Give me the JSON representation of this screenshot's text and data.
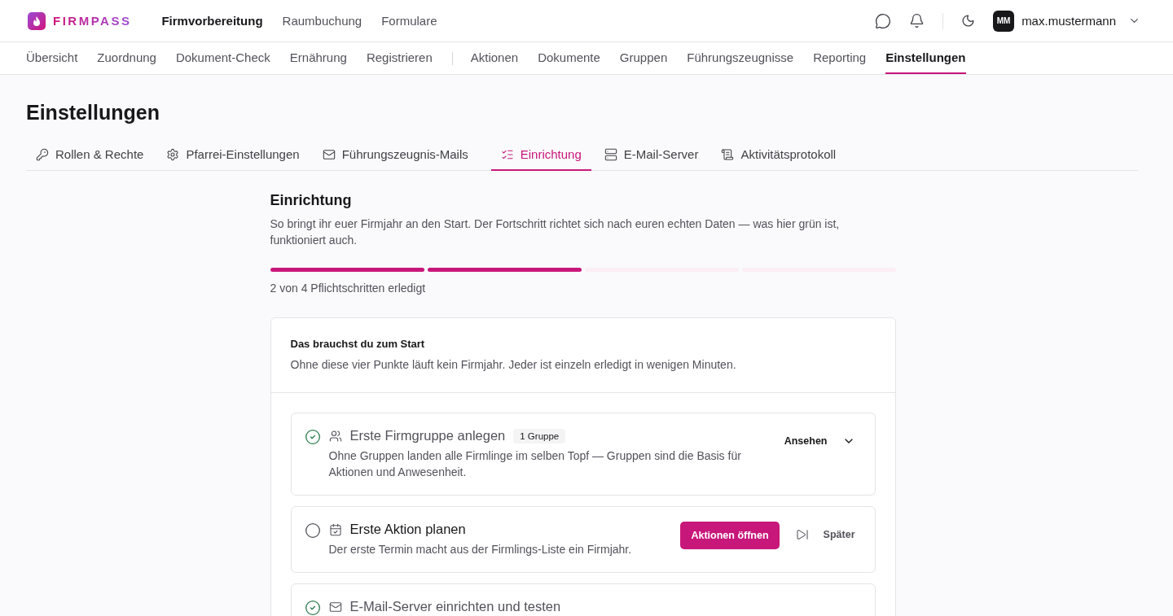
{
  "brand": {
    "name": "FIRMPASS"
  },
  "main_nav": [
    {
      "label": "Firmvorbereitung",
      "selected": true
    },
    {
      "label": "Raumbuchung",
      "selected": false
    },
    {
      "label": "Formulare",
      "selected": false
    }
  ],
  "user": {
    "initials": "MM",
    "name": "max.mustermann"
  },
  "sub_nav": [
    [
      {
        "label": "Übersicht",
        "selected": false
      },
      {
        "label": "Zuordnung",
        "selected": false
      },
      {
        "label": "Dokument-Check",
        "selected": false
      },
      {
        "label": "Ernährung",
        "selected": false
      },
      {
        "label": "Registrieren",
        "selected": false
      }
    ],
    [
      {
        "label": "Aktionen",
        "selected": false
      },
      {
        "label": "Dokumente",
        "selected": false
      },
      {
        "label": "Gruppen",
        "selected": false
      },
      {
        "label": "Führungszeugnisse",
        "selected": false
      },
      {
        "label": "Reporting",
        "selected": false
      },
      {
        "label": "Einstellungen",
        "selected": true
      }
    ]
  ],
  "page_title": "Einstellungen",
  "tabs": [
    {
      "label": "Rollen & Rechte",
      "kind": "key",
      "selected": false
    },
    {
      "label": "Pfarrei-Einstellungen",
      "kind": "gear",
      "selected": false
    },
    {
      "label": "Führungszeugnis-Mails",
      "kind": "mail",
      "selected": false
    },
    {
      "label": "Einrichtung",
      "kind": "checklist",
      "selected": true
    },
    {
      "label": "E-Mail-Server",
      "kind": "server",
      "selected": false
    },
    {
      "label": "Aktivitätsprotokoll",
      "kind": "scroll",
      "selected": false
    }
  ],
  "section": {
    "title": "Einrichtung",
    "description": "So bringt ihr euer Firmjahr an den Start. Der Fortschritt richtet sich nach euren echten Daten — was hier grün ist, funktioniert auch.",
    "progress": [
      {
        "done": true
      },
      {
        "done": true
      },
      {
        "done": false
      },
      {
        "done": false
      }
    ],
    "progress_text": "2 von 4 Pflichtschritten erledigt"
  },
  "card": {
    "title": "Das brauchst du zum Start",
    "description": "Ohne diese vier Punkte läuft kein Firmjahr. Jeder ist einzeln erledigt in wenigen Minuten.",
    "steps": [
      {
        "done": true,
        "kind": "users",
        "title": "Erste Firmgruppe anlegen",
        "badge": "1 Gruppe",
        "description": "Ohne Gruppen landen alle Firmlinge im selben Topf — Gruppen sind die Basis für Aktionen und Anwesenheit.",
        "view_label": "Ansehen"
      },
      {
        "done": false,
        "kind": "calendar",
        "title": "Erste Aktion planen",
        "description": "Der erste Termin macht aus der Firmlings-Liste ein Firmjahr.",
        "primary_label": "Aktionen öffnen",
        "later_label": "Später"
      },
      {
        "done": true,
        "kind": "mail",
        "title": "E-Mail-Server einrichten und testen"
      }
    ]
  }
}
